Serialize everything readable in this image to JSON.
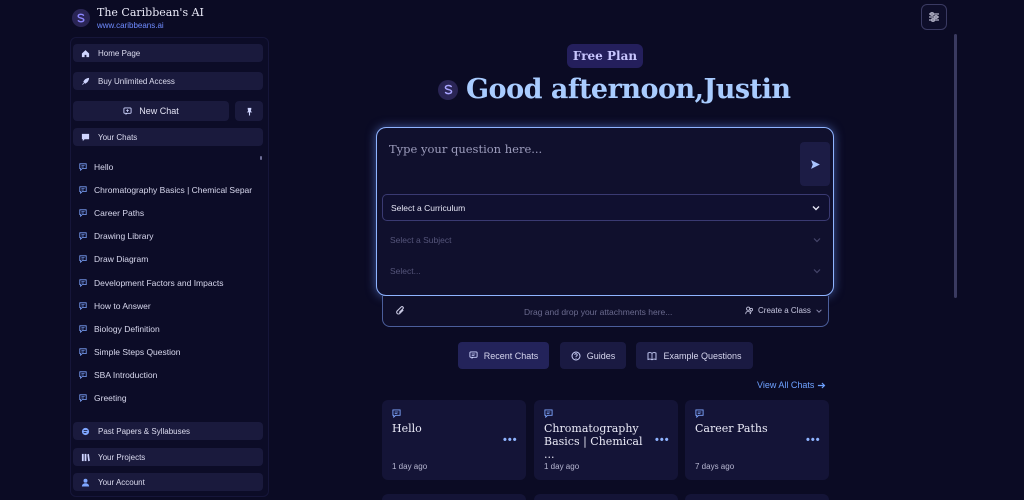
{
  "brand": {
    "name": "The Caribbean's AI",
    "url": "www.caribbeans.ai"
  },
  "sidebar": {
    "home": "Home Page",
    "buy": "Buy Unlimited Access",
    "new_chat": "New Chat",
    "your_chats": "Your Chats",
    "chats": [
      "Hello",
      "Chromatography Basics | Chemical Separ",
      "Career Paths",
      "Drawing Library",
      "Draw Diagram",
      "Development Factors and Impacts",
      "How to Answer",
      "Biology Definition",
      "Simple Steps Question",
      "SBA Introduction",
      "Greeting"
    ],
    "past_papers": "Past Papers & Syllabuses",
    "projects": "Your Projects",
    "account": "Your Account"
  },
  "main": {
    "plan": "Free Plan",
    "greeting": "Good afternoon,Justin",
    "question_placeholder": "Type your question here...",
    "curriculum": "Select a Curriculum",
    "subject": "Select a Subject",
    "select": "Select...",
    "drop": "Drag and drop your attachments here...",
    "create_class": "Create a Class",
    "tabs": [
      "Recent Chats",
      "Guides",
      "Example Questions"
    ],
    "view_all": "View All Chats",
    "cards": [
      {
        "title": "Hello",
        "date": "1 day ago"
      },
      {
        "title": "Chromatography Basics | Chemical ...",
        "date": "1 day ago"
      },
      {
        "title": "Career Paths",
        "date": "7 days ago"
      }
    ]
  },
  "colors": {
    "background": "#0b0b24",
    "accent": "#8fb4ff",
    "link": "#6ea1ff",
    "greeting": "#a9ccff",
    "plan_bg": "#241f5c"
  },
  "icons": [
    "logo-icon",
    "home-icon",
    "rocket-icon",
    "chat-icon",
    "pin-icon",
    "book-icon",
    "library-icon",
    "user-icon",
    "settings-sliders-icon",
    "send-icon",
    "chevron-down-icon",
    "paperclip-icon",
    "class-icon",
    "help-circle-icon",
    "arrow-right-icon",
    "more-icon"
  ]
}
